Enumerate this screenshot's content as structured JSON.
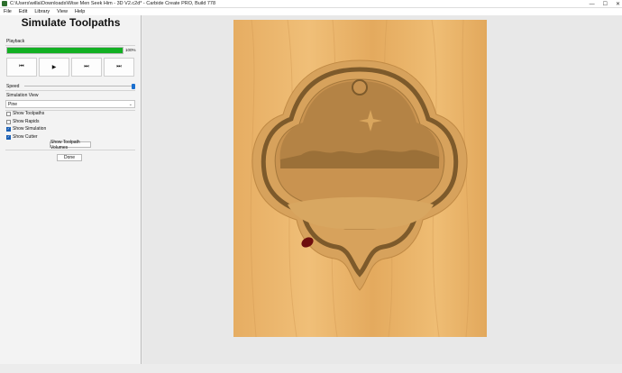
{
  "window": {
    "title": "C:\\Users\\willa\\Downloads\\Wise Men Seek Him - 3D V2.c2d* - Carbide Create PRO, Build 778",
    "minimize": "—",
    "maximize": "☐",
    "close": "✕"
  },
  "menu": [
    "File",
    "Edit",
    "Library",
    "View",
    "Help"
  ],
  "panel": {
    "title": "Simulate Toolpaths",
    "playback_label": "Playback",
    "progress": 100,
    "progress_text": "100%",
    "buttons": {
      "rewind": "⏮",
      "play": "▶",
      "step": "⏭",
      "end": "⏭"
    },
    "speed_label": "Speed",
    "speed_value": 1.0,
    "sim_view_label": "Simulation View",
    "sim_view_value": "Pine",
    "checks": [
      {
        "label": "Show Toolpaths",
        "checked": false
      },
      {
        "label": "Show Rapids",
        "checked": false
      },
      {
        "label": "Show Simulation",
        "checked": true
      },
      {
        "label": "Show Cutter",
        "checked": true
      }
    ],
    "volumes_button": "Show Toolpath Volumes",
    "done_button": "Done"
  },
  "colors": {
    "wood": "#e8b36a",
    "pocket": "#c89650",
    "deep": "#8f6a34",
    "accent": "#12b022",
    "cutter": "#7a1010"
  }
}
